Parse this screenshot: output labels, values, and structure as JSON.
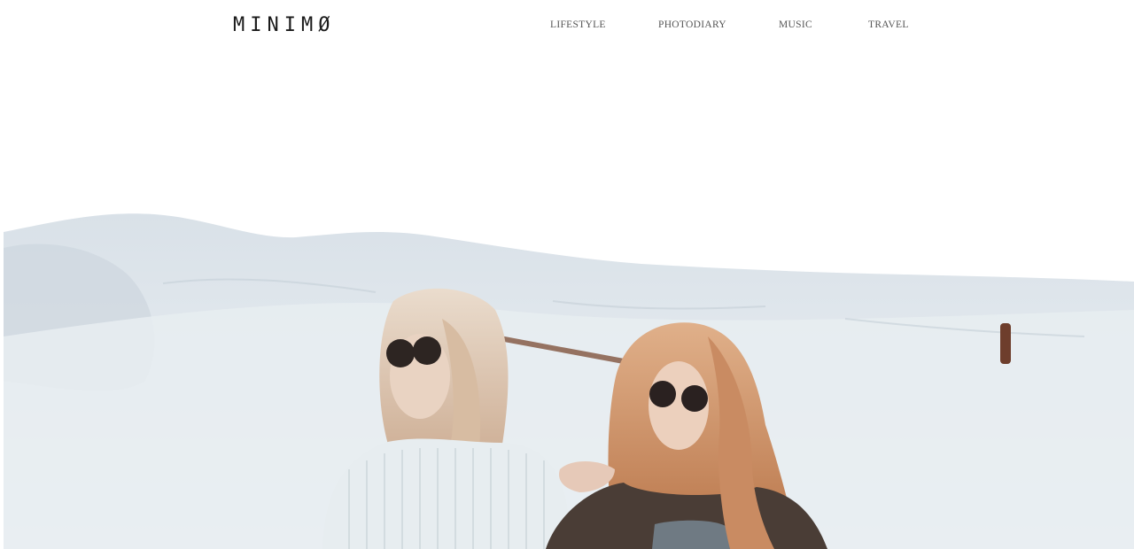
{
  "site": {
    "logo": "MINIMØ"
  },
  "nav": {
    "items": [
      {
        "label": "LIFESTYLE"
      },
      {
        "label": "PHOTODIARY"
      },
      {
        "label": "MUSIC"
      },
      {
        "label": "TRAVEL"
      }
    ]
  },
  "hero": {
    "colors": {
      "dune": "#dfe6ec",
      "dune_shadow": "#c9d3dc",
      "hair_left": "#d9bda4",
      "hair_right": "#c98b62",
      "sweater": "#e7edf0",
      "jacket": "#4a3d36"
    }
  }
}
